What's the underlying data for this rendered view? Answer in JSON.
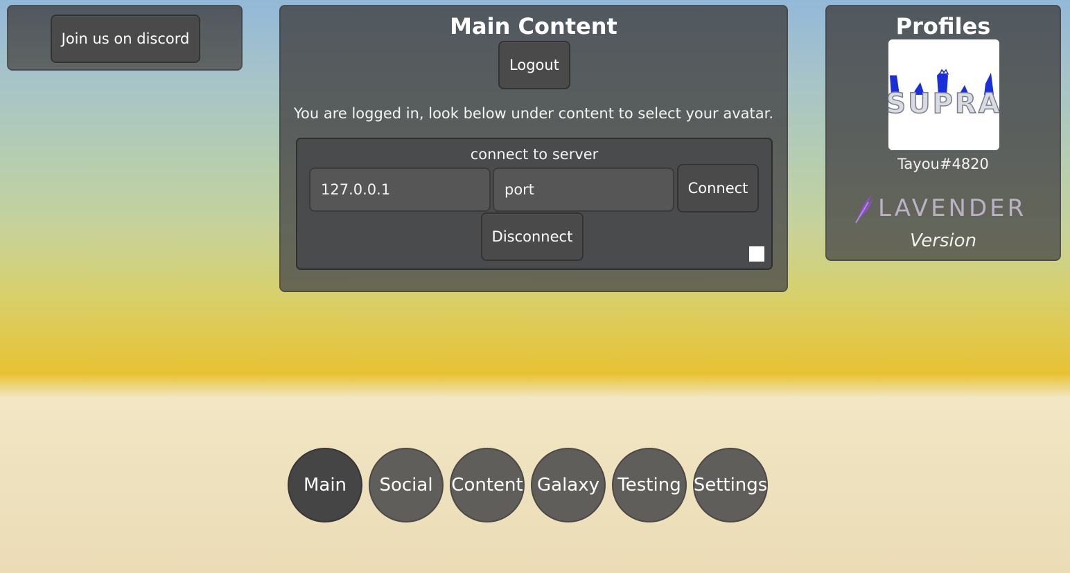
{
  "discord": {
    "button_label": "Join us on discord"
  },
  "main": {
    "title": "Main Content",
    "logout_label": "Logout",
    "status_text": "You are logged in, look below under content to select your avatar.",
    "connect": {
      "title": "connect to server",
      "ip_value": "127.0.0.1",
      "port_placeholder": "port",
      "connect_label": "Connect",
      "disconnect_label": "Disconnect"
    }
  },
  "profiles": {
    "title": "Profiles",
    "username": "Tayou#4820",
    "avatar_text": "SUPRA",
    "logo_text": "LAVENDER",
    "version_label": "Version"
  },
  "nav": {
    "items": [
      {
        "label": "Main",
        "active": true
      },
      {
        "label": "Social",
        "active": false
      },
      {
        "label": "Content",
        "active": false
      },
      {
        "label": "Galaxy",
        "active": false
      },
      {
        "label": "Testing",
        "active": false
      },
      {
        "label": "Settings",
        "active": false
      }
    ]
  },
  "colors": {
    "panel_bg": "#4a4c50",
    "button_bg": "#4a4a4a",
    "nav_active": "#454545",
    "nav_inactive": "#5f5e5b",
    "avatar_blue": "#1a2fd8",
    "logo_purple": "#8a4fc8"
  }
}
